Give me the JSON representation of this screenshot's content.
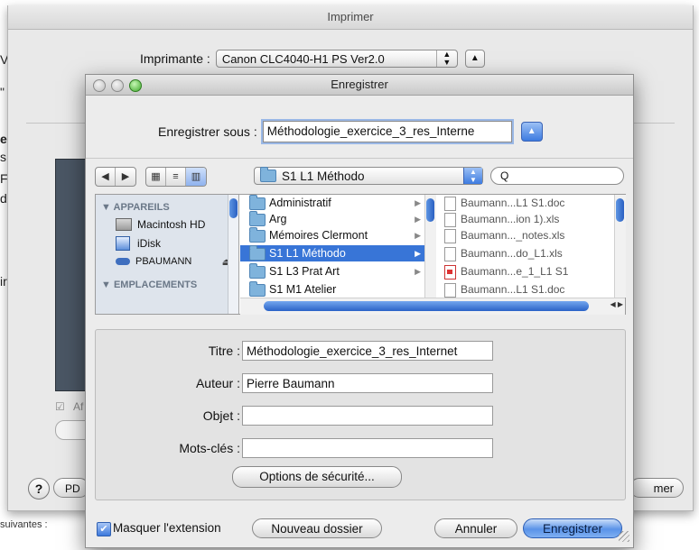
{
  "background": {
    "fragments": [
      "V",
      "\"",
      "e",
      "s",
      "F",
      "du",
      "ir"
    ],
    "bottom_text": "suivantes :"
  },
  "print_dialog": {
    "title": "Imprimer",
    "printer_label": "Imprimante :",
    "printer_value": "Canon CLC4040-H1 PS Ver2.0",
    "left_checkbox_label": "Af",
    "help_label": "?",
    "pdf_label": "PD",
    "print_label": "mer"
  },
  "save_dialog": {
    "title": "Enregistrer",
    "save_as_label": "Enregistrer sous :",
    "save_as_value": "Méthodologie_exercice_3_res_Interne",
    "location": "S1 L1 Méthodo",
    "search_placeholder": "",
    "sidebar": {
      "devices_header": "▼ APPAREILS",
      "devices": [
        "Macintosh HD",
        "iDisk",
        "PBAUMANN"
      ],
      "places_header": "▼ EMPLACEMENTS"
    },
    "folders": [
      "Administratif",
      "Arg",
      "Mémoires Clermont",
      "S1 L1 Méthodo",
      "S1 L3 Prat Art",
      "S1 M1 Atelier"
    ],
    "selected_folder": "S1 L1 Méthodo",
    "files": [
      "Baumann...L1 S1.doc",
      "Baumann...ion 1).xls",
      "Baumann..._notes.xls",
      "Baumann...do_L1.xls",
      "Baumann...e_1_L1 S1",
      "Baumann...L1 S1.doc"
    ],
    "metadata": {
      "title_label": "Titre :",
      "title_value": "Méthodologie_exercice_3_res_Internet",
      "author_label": "Auteur :",
      "author_value": "Pierre Baumann",
      "subject_label": "Objet :",
      "subject_value": "",
      "keywords_label": "Mots-clés :",
      "keywords_value": ""
    },
    "security_button": "Options de sécurité...",
    "hide_extension_label": "Masquer l'extension",
    "new_folder_button": "Nouveau dossier",
    "cancel_button": "Annuler",
    "save_button": "Enregistrer"
  },
  "colors": {
    "selection": "#3875d7",
    "accent": "#3d7be0",
    "sidebar_bg": "#dee4ec"
  }
}
